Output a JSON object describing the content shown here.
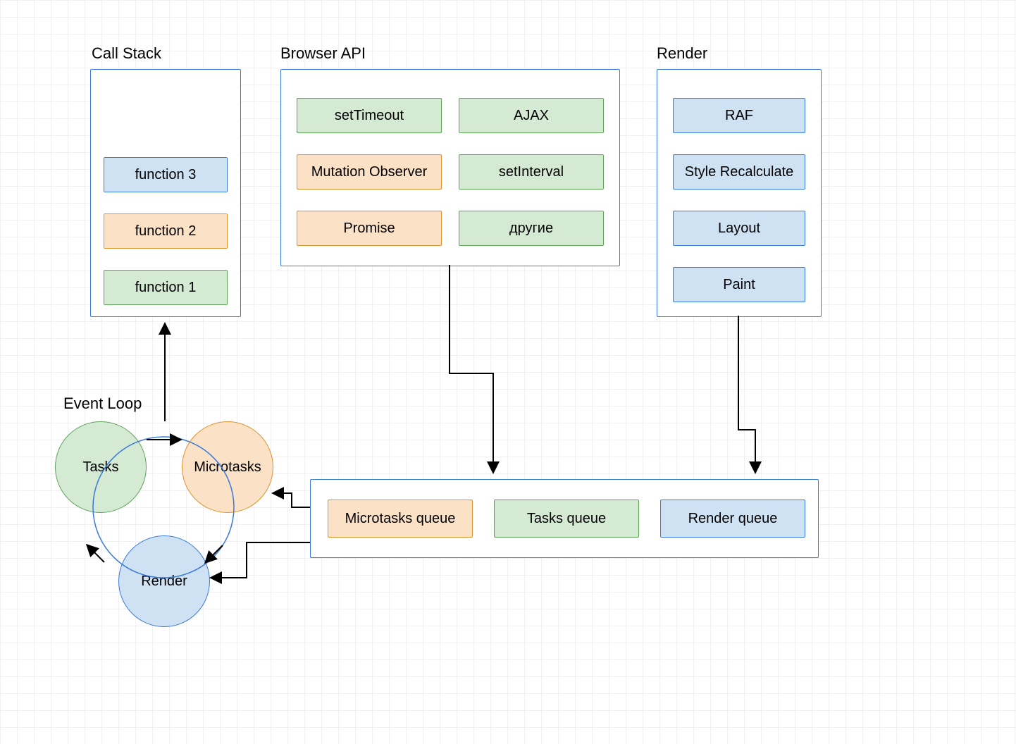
{
  "callStack": {
    "title": "Call Stack",
    "items": [
      "function 3",
      "function 2",
      "function 1"
    ]
  },
  "browserApi": {
    "title": "Browser API",
    "items": [
      {
        "label": "setTimeout",
        "color": "green"
      },
      {
        "label": "AJAX",
        "color": "green"
      },
      {
        "label": "Mutation Observer",
        "color": "orange"
      },
      {
        "label": "setInterval",
        "color": "green"
      },
      {
        "label": "Promise",
        "color": "orange"
      },
      {
        "label": "другие",
        "color": "green"
      }
    ]
  },
  "render": {
    "title": "Render",
    "items": [
      "RAF",
      "Style Recalculate",
      "Layout",
      "Paint"
    ]
  },
  "eventLoop": {
    "title": "Event Loop",
    "tasks": "Tasks",
    "microtasks": "Microtasks",
    "render": "Render"
  },
  "queues": {
    "microtasks": "Microtasks queue",
    "tasks": "Tasks queue",
    "render": "Render queue"
  },
  "colors": {
    "blueBorder": "#3a7ad9",
    "blueFill": "#cfe2f3",
    "greenBorder": "#5fa35b",
    "greenFill": "#d5ead3",
    "orangeBorder": "#e0922e",
    "orangeFill": "#fbe1c6"
  }
}
